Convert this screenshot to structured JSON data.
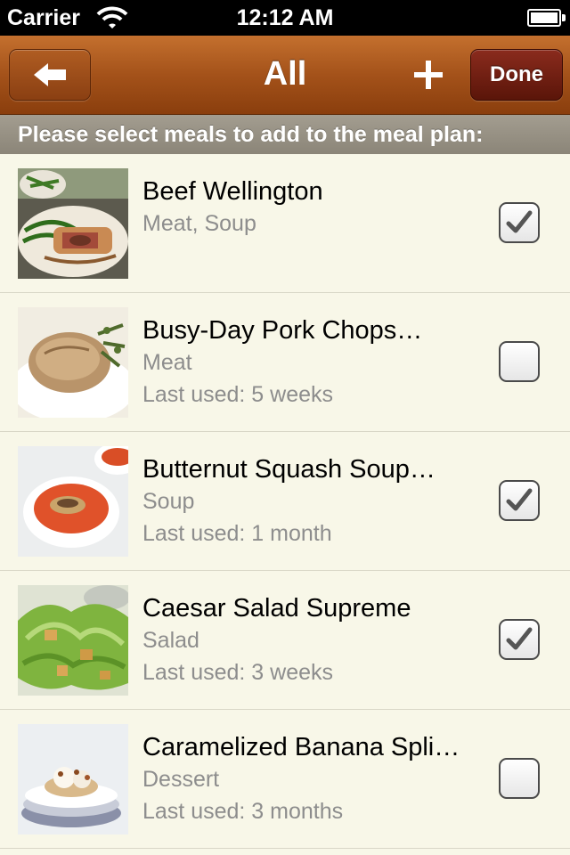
{
  "status_bar": {
    "carrier": "Carrier",
    "time": "12:12 AM",
    "icons": [
      "wifi-icon",
      "battery-icon"
    ]
  },
  "nav": {
    "title": "All",
    "back_icon": "arrow-left-icon",
    "add_icon": "plus-icon",
    "done_label": "Done"
  },
  "prompt": "Please select meals to add to the meal plan:",
  "meals": [
    {
      "name": "Beef Wellington",
      "category": "Meat, Soup",
      "last_used": "",
      "checked": true,
      "image": "beef-wellington-photo"
    },
    {
      "name": "Busy-Day Pork Chops…",
      "category": "Meat",
      "last_used": "Last used: 5 weeks",
      "checked": false,
      "image": "pork-chop-photo"
    },
    {
      "name": "Butternut Squash Soup…",
      "category": "Soup",
      "last_used": "Last used: 1 month",
      "checked": true,
      "image": "squash-soup-photo"
    },
    {
      "name": "Caesar Salad Supreme",
      "category": "Salad",
      "last_used": "Last used: 3 weeks",
      "checked": true,
      "image": "caesar-salad-photo"
    },
    {
      "name": "Caramelized Banana Spli…",
      "category": "Dessert",
      "last_used": "Last used: 3 months",
      "checked": false,
      "image": "banana-split-photo"
    }
  ],
  "colors": {
    "nav_bar": "#a4521a",
    "done_button": "#6e1d12",
    "prompt_bar": "#979185",
    "list_background": "#f8f7e8",
    "secondary_text": "#8d8d8d"
  }
}
